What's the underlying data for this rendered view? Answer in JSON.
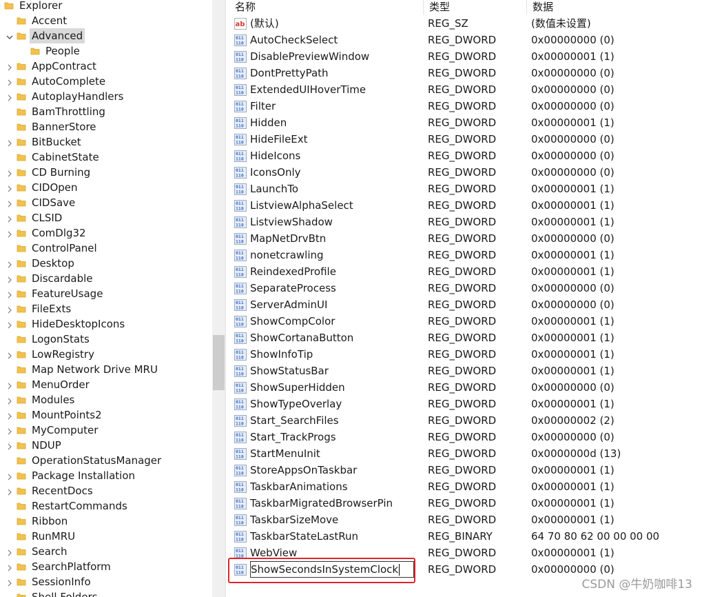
{
  "tree": {
    "items": [
      {
        "label": "Explorer",
        "level": 0,
        "chevron": "chevron-down",
        "selected": false,
        "open_folder": true
      },
      {
        "label": "Accent",
        "level": 1,
        "chevron": "none",
        "selected": false
      },
      {
        "label": "Advanced",
        "level": 1,
        "chevron": "chevron-down",
        "selected": true,
        "open_folder": true
      },
      {
        "label": "People",
        "level": 2,
        "chevron": "none",
        "selected": false
      },
      {
        "label": "AppContract",
        "level": 1,
        "chevron": "chevron-right",
        "selected": false
      },
      {
        "label": "AutoComplete",
        "level": 1,
        "chevron": "chevron-right",
        "selected": false
      },
      {
        "label": "AutoplayHandlers",
        "level": 1,
        "chevron": "chevron-right",
        "selected": false
      },
      {
        "label": "BamThrottling",
        "level": 1,
        "chevron": "none",
        "selected": false
      },
      {
        "label": "BannerStore",
        "level": 1,
        "chevron": "none",
        "selected": false
      },
      {
        "label": "BitBucket",
        "level": 1,
        "chevron": "chevron-right",
        "selected": false
      },
      {
        "label": "CabinetState",
        "level": 1,
        "chevron": "none",
        "selected": false
      },
      {
        "label": "CD Burning",
        "level": 1,
        "chevron": "chevron-right",
        "selected": false
      },
      {
        "label": "CIDOpen",
        "level": 1,
        "chevron": "chevron-right",
        "selected": false
      },
      {
        "label": "CIDSave",
        "level": 1,
        "chevron": "chevron-right",
        "selected": false
      },
      {
        "label": "CLSID",
        "level": 1,
        "chevron": "chevron-right",
        "selected": false
      },
      {
        "label": "ComDlg32",
        "level": 1,
        "chevron": "chevron-right",
        "selected": false
      },
      {
        "label": "ControlPanel",
        "level": 1,
        "chevron": "none",
        "selected": false
      },
      {
        "label": "Desktop",
        "level": 1,
        "chevron": "chevron-right",
        "selected": false
      },
      {
        "label": "Discardable",
        "level": 1,
        "chevron": "chevron-right",
        "selected": false
      },
      {
        "label": "FeatureUsage",
        "level": 1,
        "chevron": "chevron-right",
        "selected": false
      },
      {
        "label": "FileExts",
        "level": 1,
        "chevron": "chevron-right",
        "selected": false
      },
      {
        "label": "HideDesktopIcons",
        "level": 1,
        "chevron": "chevron-right",
        "selected": false
      },
      {
        "label": "LogonStats",
        "level": 1,
        "chevron": "none",
        "selected": false
      },
      {
        "label": "LowRegistry",
        "level": 1,
        "chevron": "chevron-right",
        "selected": false
      },
      {
        "label": "Map Network Drive MRU",
        "level": 1,
        "chevron": "none",
        "selected": false
      },
      {
        "label": "MenuOrder",
        "level": 1,
        "chevron": "chevron-right",
        "selected": false
      },
      {
        "label": "Modules",
        "level": 1,
        "chevron": "chevron-right",
        "selected": false
      },
      {
        "label": "MountPoints2",
        "level": 1,
        "chevron": "chevron-right",
        "selected": false
      },
      {
        "label": "MyComputer",
        "level": 1,
        "chevron": "chevron-right",
        "selected": false
      },
      {
        "label": "NDUP",
        "level": 1,
        "chevron": "chevron-right",
        "selected": false
      },
      {
        "label": "OperationStatusManager",
        "level": 1,
        "chevron": "none",
        "selected": false
      },
      {
        "label": "Package Installation",
        "level": 1,
        "chevron": "chevron-right",
        "selected": false
      },
      {
        "label": "RecentDocs",
        "level": 1,
        "chevron": "chevron-right",
        "selected": false
      },
      {
        "label": "RestartCommands",
        "level": 1,
        "chevron": "none",
        "selected": false
      },
      {
        "label": "Ribbon",
        "level": 1,
        "chevron": "none",
        "selected": false
      },
      {
        "label": "RunMRU",
        "level": 1,
        "chevron": "none",
        "selected": false
      },
      {
        "label": "Search",
        "level": 1,
        "chevron": "chevron-right",
        "selected": false
      },
      {
        "label": "SearchPlatform",
        "level": 1,
        "chevron": "chevron-right",
        "selected": false
      },
      {
        "label": "SessionInfo",
        "level": 1,
        "chevron": "chevron-right",
        "selected": false
      },
      {
        "label": "Shell Folders",
        "level": 1,
        "chevron": "none",
        "selected": false
      }
    ]
  },
  "list": {
    "columns": {
      "name": "名称",
      "type": "类型",
      "data": "数据"
    },
    "rows": [
      {
        "name": "(默认)",
        "type": "REG_SZ",
        "data": "(数值未设置)",
        "icon": "string-value-icon"
      },
      {
        "name": "AutoCheckSelect",
        "type": "REG_DWORD",
        "data": "0x00000000 (0)",
        "icon": "binary-value-icon"
      },
      {
        "name": "DisablePreviewWindow",
        "type": "REG_DWORD",
        "data": "0x00000001 (1)",
        "icon": "binary-value-icon"
      },
      {
        "name": "DontPrettyPath",
        "type": "REG_DWORD",
        "data": "0x00000000 (0)",
        "icon": "binary-value-icon"
      },
      {
        "name": "ExtendedUIHoverTime",
        "type": "REG_DWORD",
        "data": "0x00000000 (0)",
        "icon": "binary-value-icon"
      },
      {
        "name": "Filter",
        "type": "REG_DWORD",
        "data": "0x00000000 (0)",
        "icon": "binary-value-icon"
      },
      {
        "name": "Hidden",
        "type": "REG_DWORD",
        "data": "0x00000001 (1)",
        "icon": "binary-value-icon"
      },
      {
        "name": "HideFileExt",
        "type": "REG_DWORD",
        "data": "0x00000000 (0)",
        "icon": "binary-value-icon"
      },
      {
        "name": "HideIcons",
        "type": "REG_DWORD",
        "data": "0x00000000 (0)",
        "icon": "binary-value-icon"
      },
      {
        "name": "IconsOnly",
        "type": "REG_DWORD",
        "data": "0x00000000 (0)",
        "icon": "binary-value-icon"
      },
      {
        "name": "LaunchTo",
        "type": "REG_DWORD",
        "data": "0x00000001 (1)",
        "icon": "binary-value-icon"
      },
      {
        "name": "ListviewAlphaSelect",
        "type": "REG_DWORD",
        "data": "0x00000001 (1)",
        "icon": "binary-value-icon"
      },
      {
        "name": "ListviewShadow",
        "type": "REG_DWORD",
        "data": "0x00000001 (1)",
        "icon": "binary-value-icon"
      },
      {
        "name": "MapNetDrvBtn",
        "type": "REG_DWORD",
        "data": "0x00000000 (0)",
        "icon": "binary-value-icon"
      },
      {
        "name": "nonetcrawling",
        "type": "REG_DWORD",
        "data": "0x00000001 (1)",
        "icon": "binary-value-icon"
      },
      {
        "name": "ReindexedProfile",
        "type": "REG_DWORD",
        "data": "0x00000001 (1)",
        "icon": "binary-value-icon"
      },
      {
        "name": "SeparateProcess",
        "type": "REG_DWORD",
        "data": "0x00000000 (0)",
        "icon": "binary-value-icon"
      },
      {
        "name": "ServerAdminUI",
        "type": "REG_DWORD",
        "data": "0x00000000 (0)",
        "icon": "binary-value-icon"
      },
      {
        "name": "ShowCompColor",
        "type": "REG_DWORD",
        "data": "0x00000001 (1)",
        "icon": "binary-value-icon"
      },
      {
        "name": "ShowCortanaButton",
        "type": "REG_DWORD",
        "data": "0x00000001 (1)",
        "icon": "binary-value-icon"
      },
      {
        "name": "ShowInfoTip",
        "type": "REG_DWORD",
        "data": "0x00000001 (1)",
        "icon": "binary-value-icon"
      },
      {
        "name": "ShowStatusBar",
        "type": "REG_DWORD",
        "data": "0x00000001 (1)",
        "icon": "binary-value-icon"
      },
      {
        "name": "ShowSuperHidden",
        "type": "REG_DWORD",
        "data": "0x00000000 (0)",
        "icon": "binary-value-icon"
      },
      {
        "name": "ShowTypeOverlay",
        "type": "REG_DWORD",
        "data": "0x00000001 (1)",
        "icon": "binary-value-icon"
      },
      {
        "name": "Start_SearchFiles",
        "type": "REG_DWORD",
        "data": "0x00000002 (2)",
        "icon": "binary-value-icon"
      },
      {
        "name": "Start_TrackProgs",
        "type": "REG_DWORD",
        "data": "0x00000000 (0)",
        "icon": "binary-value-icon"
      },
      {
        "name": "StartMenuInit",
        "type": "REG_DWORD",
        "data": "0x0000000d (13)",
        "icon": "binary-value-icon"
      },
      {
        "name": "StoreAppsOnTaskbar",
        "type": "REG_DWORD",
        "data": "0x00000001 (1)",
        "icon": "binary-value-icon"
      },
      {
        "name": "TaskbarAnimations",
        "type": "REG_DWORD",
        "data": "0x00000001 (1)",
        "icon": "binary-value-icon"
      },
      {
        "name": "TaskbarMigratedBrowserPin",
        "type": "REG_DWORD",
        "data": "0x00000001 (1)",
        "icon": "binary-value-icon"
      },
      {
        "name": "TaskbarSizeMove",
        "type": "REG_DWORD",
        "data": "0x00000001 (1)",
        "icon": "binary-value-icon"
      },
      {
        "name": "TaskbarStateLastRun",
        "type": "REG_BINARY",
        "data": "64 70 80 62 00 00 00 00",
        "icon": "binary-value-icon"
      },
      {
        "name": "WebView",
        "type": "REG_DWORD",
        "data": "0x00000001 (1)",
        "icon": "binary-value-icon"
      },
      {
        "name": "ShowSecondsInSystemClock",
        "type": "REG_DWORD",
        "data": "0x00000000 (0)",
        "icon": "binary-value-icon",
        "editing": true
      }
    ]
  },
  "colors": {
    "folder": "#f2c14e",
    "folder_dark": "#d9a62a",
    "selection": "#d9d9d9",
    "highlight_box": "#e0232b",
    "icon_blue": "#3b6fc7"
  },
  "watermark": "CSDN @牛奶咖啡13"
}
